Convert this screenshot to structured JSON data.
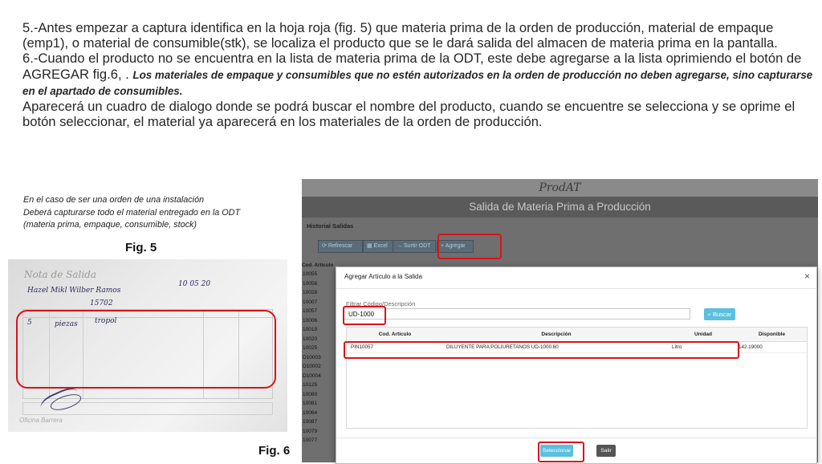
{
  "instructions": {
    "p5": "5.-Antes empezar a captura identifica en la hoja roja (fig. 5) que materia prima de la orden de producción, material de empaque (emp1), o material de consumible(stk), se localiza el producto que se le dará salida del almacen de materia prima en la pantalla.",
    "p6_start": "6.-Cuando el producto no se encuentra en la lista de materia prima de la ODT, este debe agregarse a la lista oprimiendo el botón de AGREGAR fig.6, . ",
    "p6_emphasis": "Los materiales de empaque y consumibles que no estén autorizados en la orden de producción no deben agregarse, sino capturarse en el apartado de consumibles.",
    "p6_end": "Aparecerá un cuadro de dialogo donde se podrá buscar el nombre del producto, cuando se encuentre se selecciona y se oprime el botón seleccionar, el material ya aparecerá en los materiales de la orden de producción."
  },
  "fig5": {
    "caption_lines": [
      "En el caso de ser una orden de una instalación",
      "Deberá capturarse todo el material entregado en la ODT",
      "(materia prima, empaque, consumible, stock)"
    ],
    "label": "Fig. 5",
    "photo": {
      "form_title": "Nota de Salida",
      "handwriting_name": "Hazel Mikl Wilber Ramos",
      "handwriting_number": "15702",
      "handwriting_date": "10 05 20",
      "handwriting_qty": "5",
      "handwriting_unit": "piezas",
      "handwriting_item": "tropol",
      "footer_text": "Oficina Barrera"
    }
  },
  "fig6": {
    "label": "Fig. 6",
    "app": {
      "brand": "ProdAT",
      "banner": "Salida de Materia Prima a Producción",
      "section": "Historial Salidas",
      "toolbar": {
        "refresh": "Refrescar",
        "excel": "Excel",
        "surtir": "Surtir ODT",
        "agregar": "Agregar"
      },
      "column_header": "Cod. Articulo",
      "row_codes": [
        "10055",
        "10056",
        "10028",
        "10007",
        "10057",
        "10006",
        "10019",
        "10020",
        "10025",
        "D10003",
        "D10002",
        "D10004",
        "10125",
        "10080",
        "10081",
        "10064",
        "10087",
        "10079",
        "10077"
      ]
    },
    "dialog": {
      "title": "Agregar Artículo a la Salida",
      "close": "×",
      "filter_label": "Filtrar Código/Descripción",
      "filter_value": "UD-1000",
      "search_button": "Buscar",
      "columns": [
        "Cod. Artículo",
        "Descripción",
        "Unidad",
        "Disponible"
      ],
      "rows": [
        {
          "code": "PIN10057",
          "description": "DILUYENTE PARA POLIURETANOS UD-1000.60",
          "unit": "Litro",
          "available": "142.19000"
        }
      ],
      "select_button": "Seleccionar",
      "exit_button": "Salir"
    }
  },
  "colors": {
    "highlight_red": "#d8141a",
    "button_blue": "#5bc0de",
    "app_gray": "#6f6f6f"
  }
}
